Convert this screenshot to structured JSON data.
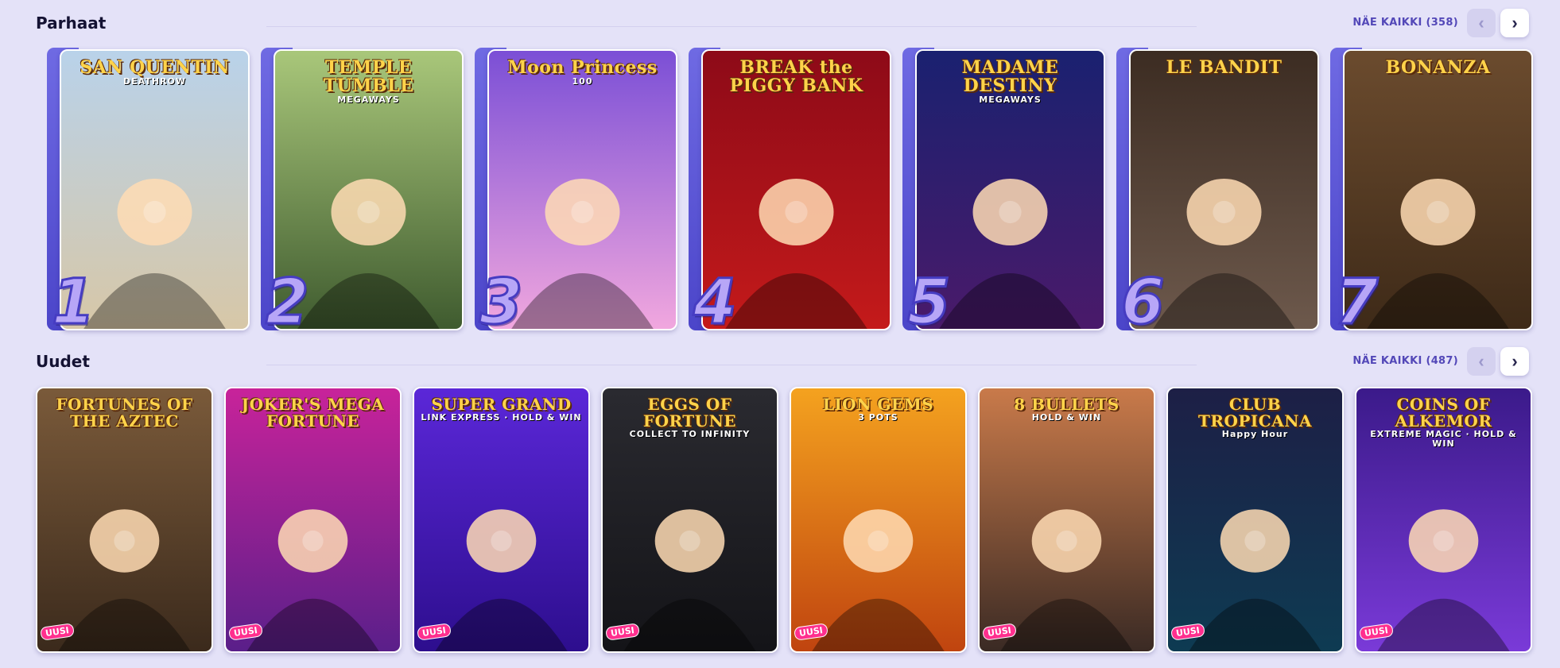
{
  "sections": {
    "top": {
      "title": "Parhaat",
      "see_all": "NÄE KAIKKI (358)",
      "games": [
        {
          "rank": "1",
          "logo": "SAN QUENTIN",
          "sub": "DEATHROW",
          "colors": [
            "#b9d2ea",
            "#d7c7a7"
          ]
        },
        {
          "rank": "2",
          "logo": "TEMPLE TUMBLE",
          "sub": "MEGAWAYS",
          "colors": [
            "#a9c77a",
            "#3f5b2f"
          ]
        },
        {
          "rank": "3",
          "logo": "Moon Princess",
          "sub": "100",
          "colors": [
            "#7b4fd6",
            "#f1a7de"
          ]
        },
        {
          "rank": "4",
          "logo": "BREAK the PIGGY BANK",
          "sub": "",
          "colors": [
            "#8d0a18",
            "#c41a1a"
          ]
        },
        {
          "rank": "5",
          "logo": "MADAME DESTINY",
          "sub": "MEGAWAYS",
          "colors": [
            "#1a2170",
            "#4a1a6a"
          ]
        },
        {
          "rank": "6",
          "logo": "LE BANDIT",
          "sub": "",
          "colors": [
            "#3c2c22",
            "#6d594c"
          ]
        },
        {
          "rank": "7",
          "logo": "BONANZA",
          "sub": "",
          "colors": [
            "#6b4b2e",
            "#3e2a18"
          ]
        }
      ]
    },
    "new": {
      "title": "Uudet",
      "see_all": "NÄE KAIKKI (487)",
      "badge": "UUSI",
      "games": [
        {
          "logo": "FORTUNES OF THE AZTEC",
          "sub": "",
          "colors": [
            "#7a5a3a",
            "#3b2a1c"
          ]
        },
        {
          "logo": "JOKER'S MEGA FORTUNE",
          "sub": "",
          "colors": [
            "#c8239a",
            "#5a1f8a"
          ]
        },
        {
          "logo": "SUPER GRAND",
          "sub": "LINK EXPRESS · HOLD & WIN",
          "colors": [
            "#5b27d8",
            "#2d0e8e"
          ]
        },
        {
          "logo": "EGGS OF FORTUNE",
          "sub": "COLLECT TO INFINITY",
          "colors": [
            "#2a2a30",
            "#141418"
          ]
        },
        {
          "logo": "LION GEMS",
          "sub": "3 POTS",
          "colors": [
            "#f4a21f",
            "#c0440f"
          ]
        },
        {
          "logo": "8 BULLETS",
          "sub": "HOLD & WIN",
          "colors": [
            "#c97a4a",
            "#3a2a24"
          ]
        },
        {
          "logo": "CLUB TROPICANA",
          "sub": "Happy Hour",
          "colors": [
            "#1d1f46",
            "#0e3b52"
          ]
        },
        {
          "logo": "COINS OF ALKEMOR",
          "sub": "EXTREME MAGIC · HOLD & WIN",
          "colors": [
            "#3b1a8a",
            "#7a3ad8"
          ]
        }
      ]
    }
  }
}
